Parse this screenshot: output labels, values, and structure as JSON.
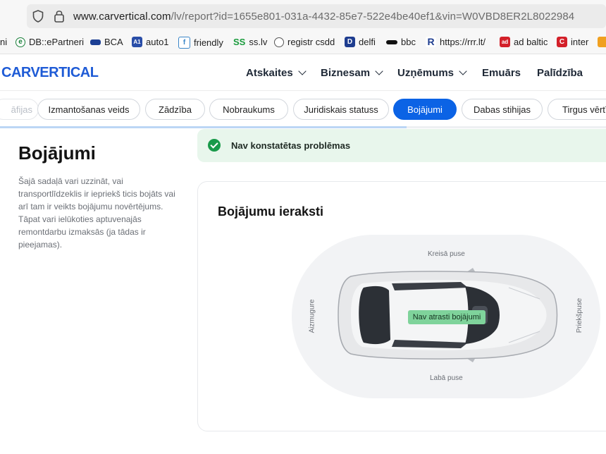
{
  "browser": {
    "url_prefix": "www.carvertical.com",
    "url_rest": "/lv/report?id=1655e801-031a-4432-85e7-522e4be40ef1&vin=W0VBD8ER2L8022984"
  },
  "bookmarks": [
    {
      "label": "ni",
      "icon": "page-icon"
    },
    {
      "label": "DB::ePartneri",
      "icon": "db-icon"
    },
    {
      "label": "BCA",
      "icon": "bca-icon"
    },
    {
      "label": "auto1",
      "icon": "auto1-icon"
    },
    {
      "label": "friendly",
      "icon": "friendly-icon"
    },
    {
      "label": "ss.lv",
      "icon": "ss-icon"
    },
    {
      "label": "registr csdd",
      "icon": "globe-icon"
    },
    {
      "label": "delfi",
      "icon": "delfi-icon"
    },
    {
      "label": "bbc",
      "icon": "bbc-icon"
    },
    {
      "label": "https://rrr.lt/",
      "icon": "rrr-icon"
    },
    {
      "label": "ad baltic",
      "icon": "adbaltic-icon"
    },
    {
      "label": "inter",
      "icon": "inter-icon"
    }
  ],
  "header": {
    "logo": "CARVERTICAL",
    "nav": [
      {
        "label": "Atskaites",
        "has_dropdown": true
      },
      {
        "label": "Biznesam",
        "has_dropdown": true
      },
      {
        "label": "Uzņēmums",
        "has_dropdown": true
      },
      {
        "label": "Emuārs",
        "has_dropdown": false
      },
      {
        "label": "Palīdzība",
        "has_dropdown": false
      }
    ]
  },
  "tabs": [
    {
      "label": "āfijas",
      "active": false
    },
    {
      "label": "Izmantošanas veids",
      "active": false
    },
    {
      "label": "Zādzība",
      "active": false
    },
    {
      "label": "Nobraukums",
      "active": false
    },
    {
      "label": "Juridiskais statuss",
      "active": false
    },
    {
      "label": "Bojājumi",
      "active": true
    },
    {
      "label": "Dabas stihijas",
      "active": false
    },
    {
      "label": "Tirgus vērtīb",
      "active": false
    }
  ],
  "section": {
    "title": "Bojājumi",
    "description": "Šajā sadaļā vari uzzināt, vai transportlīdzeklis ir iepriekš ticis bojāts vai arī tam ir veikts bojājumu novērtējums. Tāpat vari ielūkoties aptuvenajās remontdarbu izmaksās (ja tādas ir pieejamas)."
  },
  "status": {
    "text": "Nav konstatētas problēmas",
    "color": "#199a4a"
  },
  "damage_card": {
    "title": "Bojājumu ieraksti",
    "labels": {
      "left": "Kreisā puse",
      "right": "Labā puse",
      "rear": "Aizmugure",
      "front": "Priekšpuse"
    },
    "badge": "Nav atrasti bojājumi"
  },
  "colors": {
    "brand": "#1e5bd6",
    "active_tab": "#0b63e5",
    "badge": "#7fd39b"
  }
}
